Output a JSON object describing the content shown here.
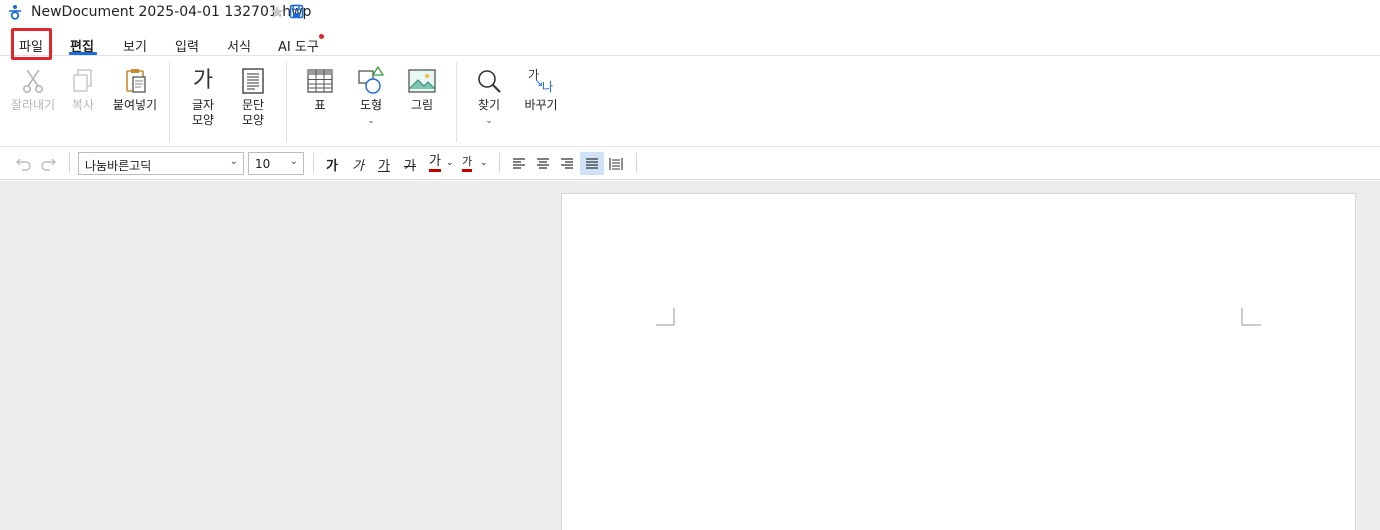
{
  "window": {
    "title": "NewDocument 2025-04-01 132701.hwp"
  },
  "menu": {
    "tabs": [
      {
        "label": "파일"
      },
      {
        "label": "편집"
      },
      {
        "label": "보기"
      },
      {
        "label": "입력"
      },
      {
        "label": "서식"
      },
      {
        "label": "AI 도구"
      }
    ],
    "active_tab": "편집"
  },
  "ribbon": {
    "cut": "잘라내기",
    "copy": "복사",
    "paste": "붙여넣기",
    "char_shape": "글자\n모양",
    "para_shape": "문단\n모양",
    "char_shape_glyph": "가",
    "table": "표",
    "shape": "도형",
    "picture": "그림",
    "find": "찾기",
    "replace": "바꾸기",
    "replace_glyph_top": "가",
    "replace_glyph_bottom": "나"
  },
  "format": {
    "font_name": "나눔바른고딕",
    "font_size": "10",
    "glyph": "가",
    "colors": {
      "accent": "#1b6ad8",
      "font_color": "#c00000",
      "highlight": "#c00000"
    }
  }
}
